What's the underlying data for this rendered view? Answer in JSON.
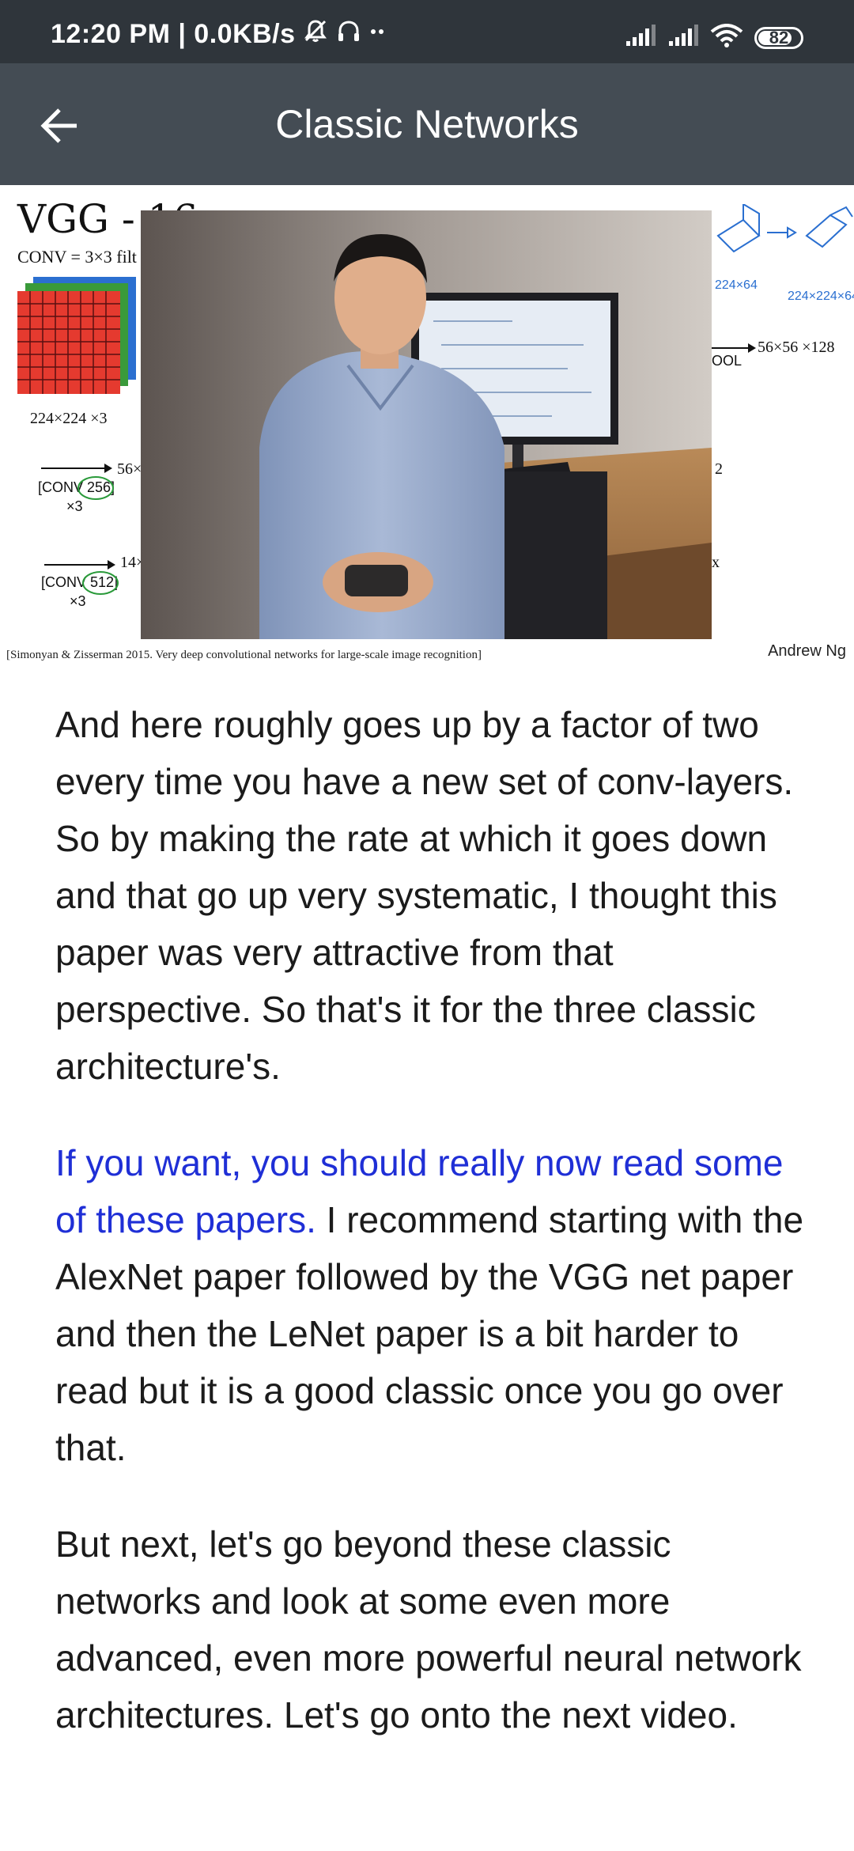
{
  "status_bar": {
    "time_speed": "12:20 PM | 0.0KB/s",
    "battery_level": "82",
    "icons": [
      "mute-bell-icon",
      "headset-icon",
      "more-dots-icon",
      "signal-icon",
      "signal-icon",
      "wifi-icon",
      "battery-icon"
    ]
  },
  "app_bar": {
    "title": "Classic Networks",
    "back_icon": "back-arrow-icon"
  },
  "slide": {
    "title": "VGG - 16",
    "conv_label": "CONV = 3×3 filt",
    "image_dims": "224×224 ×3",
    "arrow_label_1": "56×",
    "conv_block_1": "[CONV 256]",
    "conv_block_1_rep": "×3",
    "arrow_label_2": "14×",
    "conv_block_2": "[CONV 512]",
    "conv_block_2_rep": "×3",
    "pool_label": "OOL",
    "output_dims": "56×56 ×128",
    "right_num": "2",
    "right_x": "x",
    "handwritten_1": "224×64",
    "handwritten_2": "224×224×64",
    "citation": "[Simonyan & Zisserman 2015. Very deep convolutional networks for large-scale image recognition]",
    "author": "Andrew Ng"
  },
  "transcript": {
    "p1": "And here roughly goes up by a factor of two every time you have a new set of conv-layers. So by making the rate at which it goes down and that go up very systematic, I thought this paper was very attractive from that perspective. So that's it for the three classic architecture's.",
    "p2_highlight": "If you want, you should really now read some of these papers.",
    "p2_rest": " I recommend starting with the AlexNet paper followed by the VGG net paper and then the LeNet paper is a bit harder to read but it is a good classic once you go over that.",
    "p3": "But next, let's go beyond these classic networks and look at some even more advanced, even more powerful neural network architectures.  Let's go onto the next video."
  },
  "colors": {
    "status_bar": "#2f353b",
    "app_bar": "#444c54",
    "highlight": "#1f2fd6",
    "text": "#1b1b1b"
  }
}
